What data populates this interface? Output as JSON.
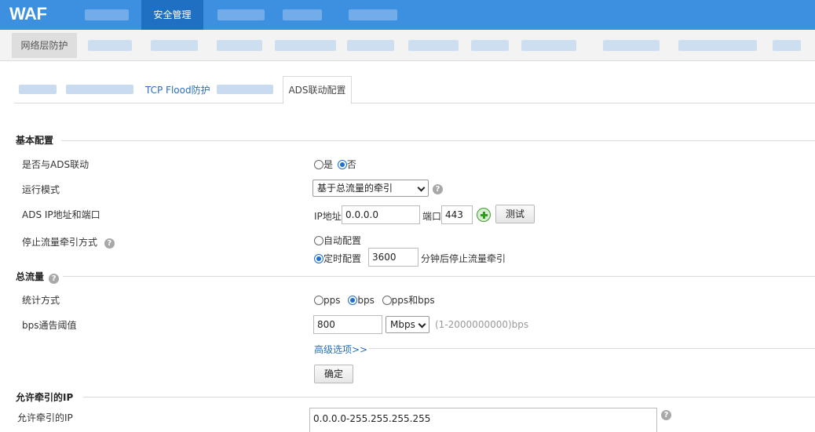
{
  "app": {
    "logo": "WAF"
  },
  "topnav": {
    "active_tab": "安全管理"
  },
  "subnav": {
    "active_item": "网络层防护"
  },
  "tabs": {
    "link_tab": "TCP Flood防护",
    "active_tab": "ADS联动配置"
  },
  "basic": {
    "title": "基本配置",
    "ads_link": {
      "label": "是否与ADS联动",
      "yes": "是",
      "no": "否",
      "selected": "否"
    },
    "run_mode": {
      "label": "运行模式",
      "value": "基于总流量的牵引"
    },
    "ads_ip": {
      "label": "ADS IP地址和端口",
      "ip_label": "IP地址",
      "ip_value": "0.0.0.0",
      "port_label": "端口",
      "port_value": "443",
      "test_button": "测试"
    },
    "stop_mode": {
      "label": "停止流量牵引方式",
      "auto": "自动配置",
      "timed": "定时配置",
      "timed_value": "3600",
      "timed_suffix": "分钟后停止流量牵引",
      "selected": "定时配置"
    }
  },
  "total": {
    "title": "总流量",
    "stat": {
      "label": "统计方式",
      "opt_pps": "pps",
      "opt_bps": "bps",
      "opt_both": "pps和bps",
      "selected": "bps"
    },
    "threshold": {
      "label": "bps通告阈值",
      "value": "800",
      "unit": "Mbps",
      "range_hint": "(1-2000000000)bps"
    },
    "advanced": "高级选项>>",
    "ok_button": "确定"
  },
  "allowed": {
    "title": "允许牵引的IP",
    "label": "允许牵引的IP",
    "value": "0.0.0.0-255.255.255.255"
  },
  "colors": {
    "nav": "#3d8fe0",
    "nav_active": "#1f6fc2",
    "link": "#2a6ebb"
  }
}
